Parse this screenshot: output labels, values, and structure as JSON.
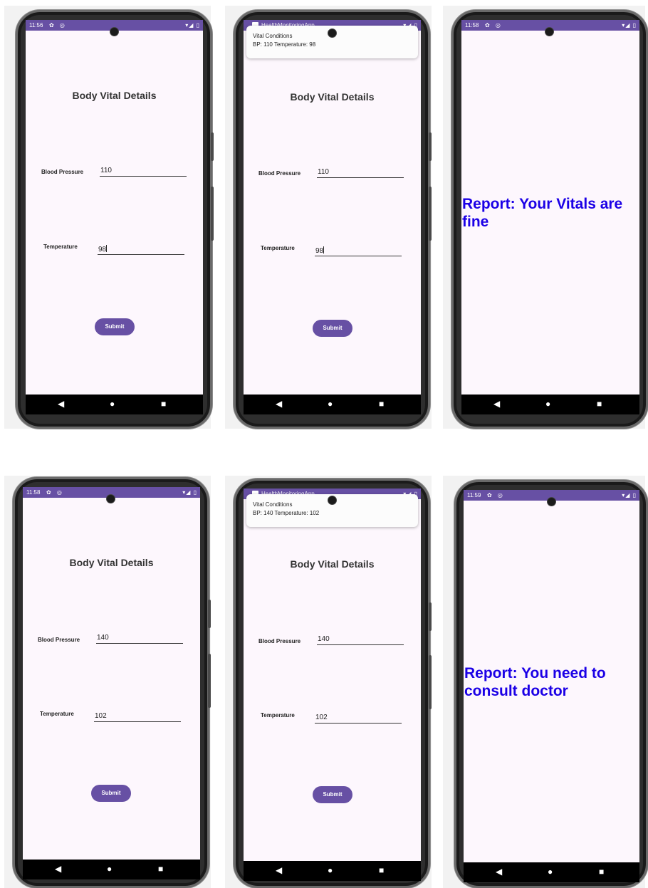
{
  "colors": {
    "accent": "#6750a4",
    "report": "#1b00e6",
    "screen": "#fdf7fd"
  },
  "icons": {
    "settings": "gear-icon",
    "sync": "sync-icon",
    "wifi": "wifi-icon",
    "signal": "signal-icon",
    "battery": "battery-icon"
  },
  "common": {
    "form_title": "Body Vital Details",
    "bp_label": "Blood Pressure",
    "temp_label": "Temperature",
    "submit_label": "Submit",
    "status_icons": "✿ ◎",
    "status_right": "▾◢ ▯",
    "app_name": "HealthMonitoringApp",
    "notif_title": "Vital Conditions",
    "nav_back": "◀",
    "nav_home": "●",
    "nav_recent": "■"
  },
  "phones": [
    {
      "time": "11:56",
      "bp": "110",
      "temp": "98"
    },
    {
      "notif_body": "BP: 110 Temperature: 98",
      "bp": "110",
      "temp": "98"
    },
    {
      "time": "11:58",
      "report": "Report: Your Vitals are fine"
    },
    {
      "time": "11:58",
      "bp": "140",
      "temp": "102"
    },
    {
      "notif_body": "BP: 140 Temperature: 102",
      "bp": "140",
      "temp": "102"
    },
    {
      "time": "11:59",
      "report": "Report: You need to consult doctor"
    }
  ]
}
